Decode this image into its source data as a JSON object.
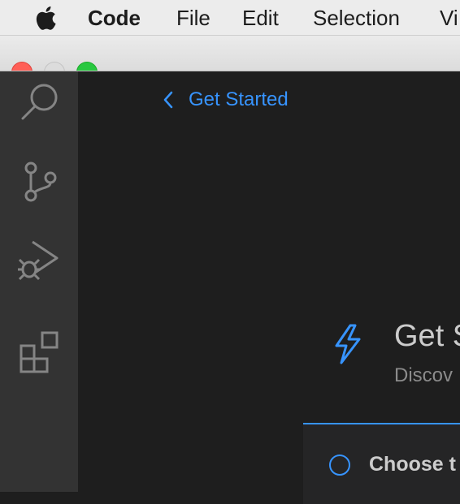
{
  "menubar": {
    "apple_icon": "apple-icon",
    "app_name": "Code",
    "items": [
      "File",
      "Edit",
      "Selection",
      "Vi"
    ]
  },
  "window": {
    "controls": [
      "close",
      "minimize",
      "zoom"
    ]
  },
  "activity_bar": {
    "items": [
      {
        "id": "search",
        "icon": "search-icon"
      },
      {
        "id": "source-control",
        "icon": "source-control-icon"
      },
      {
        "id": "run-debug",
        "icon": "run-debug-icon"
      },
      {
        "id": "extensions",
        "icon": "extensions-icon"
      }
    ]
  },
  "editor": {
    "back_label": "Get Started",
    "hero_icon": "lightning-icon",
    "title": "Get S",
    "subtitle": "Discov",
    "step": {
      "label": "Choose t"
    }
  },
  "colors": {
    "accent": "#3794ff",
    "activity_bar_bg": "#333333",
    "editor_bg": "#1e1e1e",
    "icon_gray": "#858585"
  }
}
